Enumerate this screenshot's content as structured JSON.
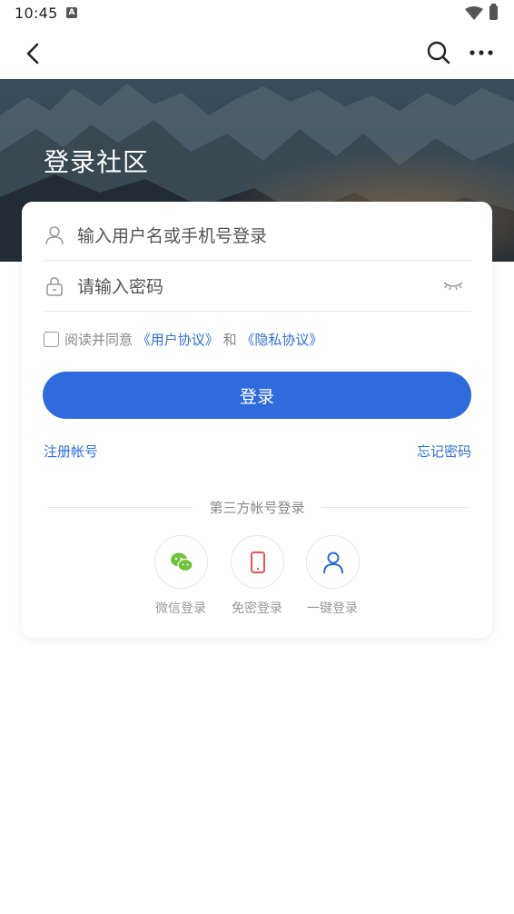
{
  "status_bar": {
    "time": "10:45",
    "notification_letter": "A"
  },
  "hero": {
    "title": "登录社区"
  },
  "login_form": {
    "username_placeholder": "输入用户名或手机号登录",
    "password_placeholder": "请输入密码",
    "agreement": {
      "prefix": "阅读并同意",
      "user_agreement": "《用户协议》",
      "conjunction": "和",
      "privacy_agreement": "《隐私协议》",
      "checked": false
    },
    "login_button": "登录",
    "register_link": "注册帐号",
    "forgot_link": "忘记密码"
  },
  "third_party": {
    "divider_label": "第三方帐号登录",
    "options": [
      {
        "label": "微信登录",
        "icon": "wechat-icon",
        "color": "#6fc43a"
      },
      {
        "label": "免密登录",
        "icon": "phone-icon",
        "color": "#e8545a"
      },
      {
        "label": "一键登录",
        "icon": "user-icon",
        "color": "#2f6bde"
      }
    ]
  },
  "colors": {
    "primary": "#2f6bde",
    "link": "#2f6fde"
  }
}
